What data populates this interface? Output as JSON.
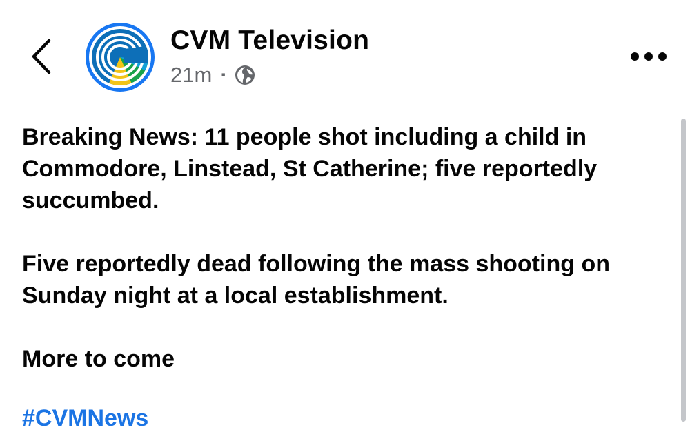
{
  "header": {
    "back_icon": "chevron-left-icon",
    "page_name": "CVM Television",
    "time_ago": "21m",
    "separator": "·",
    "audience_icon": "globe-icon",
    "more_icon": "ellipsis-horizontal-icon"
  },
  "post": {
    "paragraphs": [
      "Breaking News: 11 people shot including a child in Commodore, Linstead, St Catherine; five reportedly succumbed.",
      "Five reportedly dead following the mass shooting on Sunday night at a local establishment.",
      "More to come"
    ],
    "hashtag": "#CVMNews"
  },
  "colors": {
    "text": "#050505",
    "meta": "#65676b",
    "link": "#1b74e4",
    "avatar_ring": "#1877f2"
  }
}
